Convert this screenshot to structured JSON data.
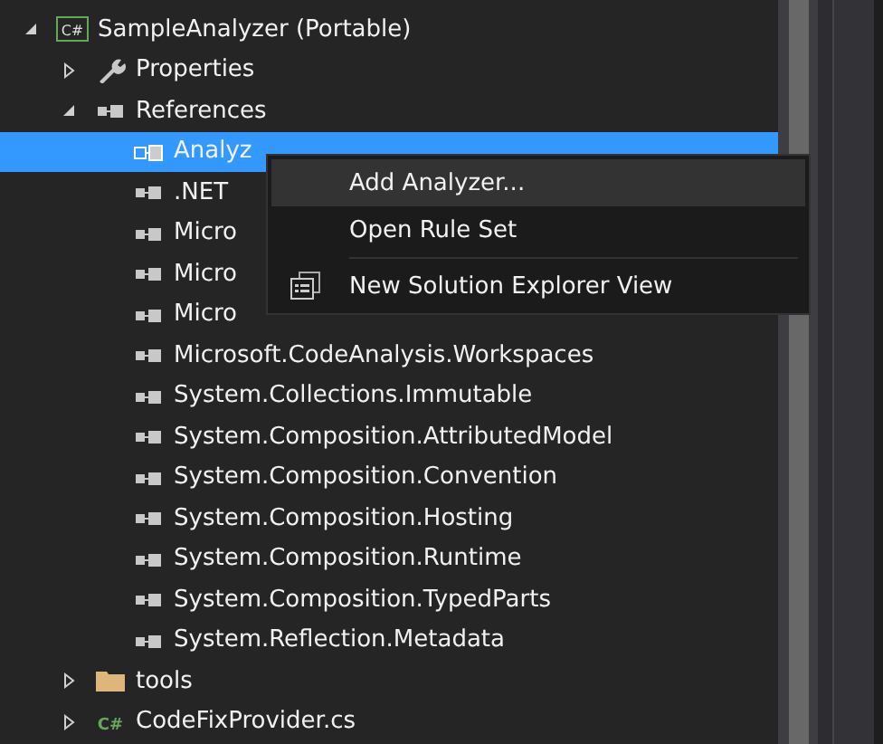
{
  "tree": {
    "items": [
      {
        "label": "SampleAnalyzer (Portable)",
        "kind": "project",
        "icon_text": "C#",
        "selected": false,
        "expanded": true,
        "children": [
          {
            "label": "Properties",
            "kind": "properties",
            "selected": false,
            "expanded": false
          },
          {
            "label": "References",
            "kind": "references",
            "selected": false,
            "expanded": true,
            "children": [
              {
                "label": "Analyz",
                "kind": "analyzers",
                "selected": true
              },
              {
                "label": ".NET",
                "kind": "reference",
                "selected": false
              },
              {
                "label": "Micro",
                "kind": "reference",
                "selected": false
              },
              {
                "label": "Micro",
                "kind": "reference",
                "selected": false
              },
              {
                "label": "Micro",
                "kind": "reference",
                "selected": false
              },
              {
                "label": "Microsoft.CodeAnalysis.Workspaces",
                "kind": "reference",
                "selected": false
              },
              {
                "label": "System.Collections.Immutable",
                "kind": "reference",
                "selected": false
              },
              {
                "label": "System.Composition.AttributedModel",
                "kind": "reference",
                "selected": false
              },
              {
                "label": "System.Composition.Convention",
                "kind": "reference",
                "selected": false
              },
              {
                "label": "System.Composition.Hosting",
                "kind": "reference",
                "selected": false
              },
              {
                "label": "System.Composition.Runtime",
                "kind": "reference",
                "selected": false
              },
              {
                "label": "System.Composition.TypedParts",
                "kind": "reference",
                "selected": false
              },
              {
                "label": "System.Reflection.Metadata",
                "kind": "reference",
                "selected": false
              }
            ]
          },
          {
            "label": "tools",
            "kind": "folder",
            "selected": false,
            "expanded": false
          },
          {
            "label": "CodeFixProvider.cs",
            "kind": "csharp-file",
            "icon_text": "C#",
            "selected": false,
            "expanded": false
          }
        ]
      }
    ]
  },
  "context_menu": {
    "items": [
      {
        "kind": "item",
        "label": "Add Analyzer...",
        "selected": true
      },
      {
        "kind": "item",
        "label": "Open Rule Set",
        "selected": false
      },
      {
        "kind": "separator"
      },
      {
        "kind": "icon-item",
        "label": "New Solution Explorer View",
        "selected": false
      }
    ]
  }
}
